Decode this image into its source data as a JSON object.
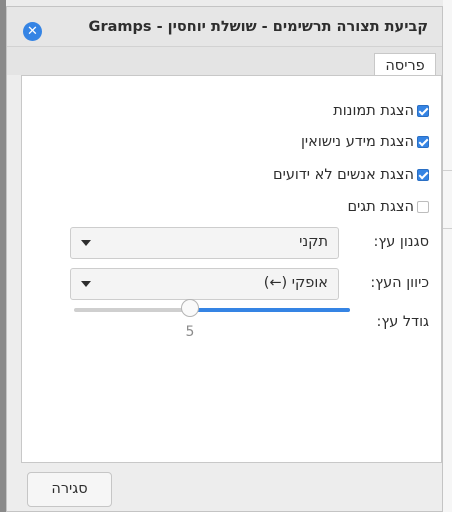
{
  "window": {
    "title": "קביעת תצורה תרשימים - שושלת יוחסין - Gramps",
    "close_icon": "close-icon",
    "accent": "#3584e4"
  },
  "tabs": [
    {
      "label": "פריסה",
      "active": true
    }
  ],
  "options": [
    {
      "label": "הצגת תמונות",
      "checked": true
    },
    {
      "label": "הצגת מידע נישואין",
      "checked": true
    },
    {
      "label": "הצגת אנשים לא ידועים",
      "checked": true
    },
    {
      "label": "הצגת תגים",
      "checked": false
    }
  ],
  "tree_style": {
    "label": "סגנון עץ:",
    "value": "תקני"
  },
  "tree_direction": {
    "label": "כיוון העץ:",
    "value": "אופקי (←)"
  },
  "tree_size": {
    "label": "גודל עץ:",
    "value": "5",
    "fraction": 0.58
  },
  "footer": {
    "close_label": "סגירה"
  }
}
